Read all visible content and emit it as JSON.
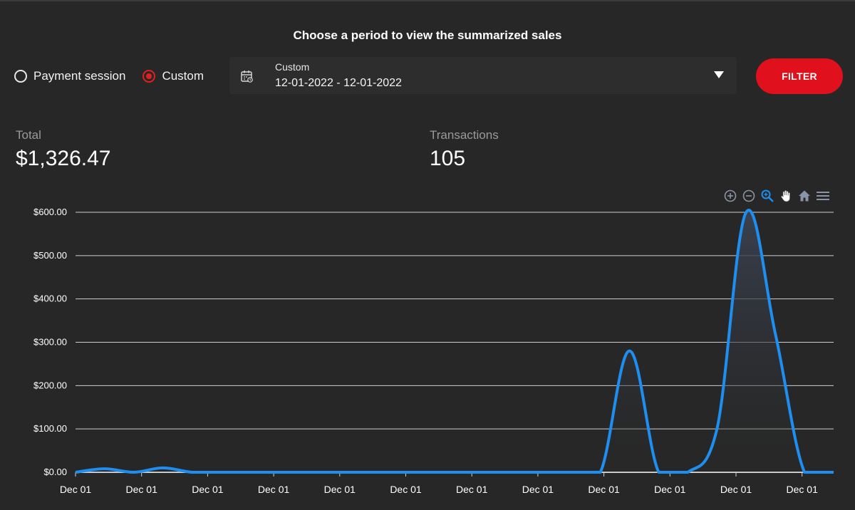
{
  "header": {
    "title": "Choose a period to view the summarized sales"
  },
  "period_options": [
    {
      "label": "Payment session",
      "checked": false
    },
    {
      "label": "Custom",
      "checked": true
    }
  ],
  "period_select": {
    "label": "Custom",
    "value": "12-01-2022 - 12-01-2022",
    "icon": "calendar-icon"
  },
  "filter_button": {
    "label": "FILTER"
  },
  "stats": {
    "total_label": "Total",
    "total_value": "$1,326.47",
    "transactions_label": "Transactions",
    "transactions_value": "105"
  },
  "toolbar": {
    "icons": [
      "zoom-in-icon",
      "zoom-out-icon",
      "selection-zoom-icon",
      "pan-icon",
      "reset-home-icon",
      "menu-icon"
    ]
  },
  "colors": {
    "accent": "#e0101c",
    "series": "#1e8ff0",
    "toolbar_active": "#1e8ff0",
    "toolbar_idle": "#8a94a8"
  },
  "chart_data": {
    "type": "area",
    "title": "",
    "xlabel": "",
    "ylabel": "",
    "ylim": [
      0,
      600
    ],
    "yticks": [
      "$0.00",
      "$100.00",
      "$200.00",
      "$300.00",
      "$400.00",
      "$500.00",
      "$600.00"
    ],
    "x_tick_labels": [
      "Dec 01",
      "Dec 01",
      "Dec 01",
      "Dec 01",
      "Dec 01",
      "Dec 01",
      "Dec 01",
      "Dec 01",
      "Dec 01",
      "Dec 01",
      "Dec 01",
      "Dec 01"
    ],
    "grid": true,
    "series": [
      {
        "values": [
          0,
          8,
          0,
          10,
          0,
          0,
          0,
          0,
          0,
          0,
          0,
          0,
          0,
          0,
          0,
          0,
          0,
          0,
          0,
          280,
          0,
          0,
          100,
          600,
          320,
          0,
          0
        ]
      }
    ]
  }
}
